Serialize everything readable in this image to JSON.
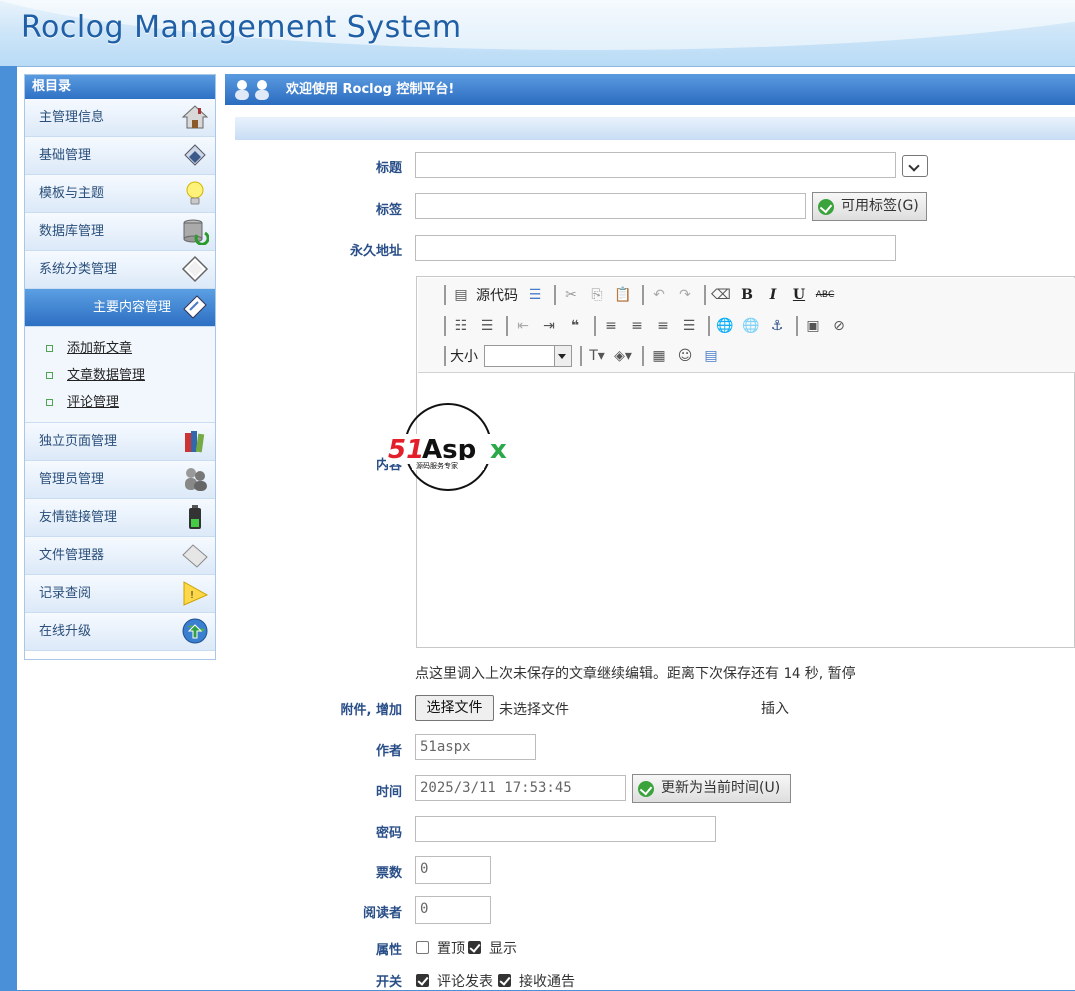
{
  "app": {
    "title": "Roclog Management System"
  },
  "sidebar": {
    "header": "根目录",
    "items": [
      {
        "label": "主管理信息",
        "icon": "house-icon"
      },
      {
        "label": "基础管理",
        "icon": "tools-icon"
      },
      {
        "label": "模板与主题",
        "icon": "lightbulb-icon"
      },
      {
        "label": "数据库管理",
        "icon": "database-icon"
      },
      {
        "label": "系统分类管理",
        "icon": "tag-icon"
      },
      {
        "label": "主要内容管理",
        "icon": "document-edit-icon"
      },
      {
        "label": "独立页面管理",
        "icon": "books-icon"
      },
      {
        "label": "管理员管理",
        "icon": "users-icon"
      },
      {
        "label": "友情链接管理",
        "icon": "battery-icon"
      },
      {
        "label": "文件管理器",
        "icon": "folder-icon"
      },
      {
        "label": "记录查阅",
        "icon": "warning-icon"
      },
      {
        "label": "在线升级",
        "icon": "globe-icon"
      }
    ],
    "subitems": [
      "添加新文章",
      "文章数据管理",
      "评论管理"
    ]
  },
  "main": {
    "header": "欢迎使用 Roclog 控制平台!",
    "form": {
      "title_label": "标题",
      "title_value": "",
      "tags_label": "标签",
      "tags_value": "",
      "tags_button": "可用标签(G)",
      "permalink_label": "永久地址",
      "permalink_value": "",
      "content_label": "内容",
      "toolbar": {
        "source_label": "源代码",
        "size_label": "大小",
        "size_value": ""
      },
      "autosave_prefix": "点这里调入上次未保存的文章继续编辑。距离下次保存还有 ",
      "autosave_seconds": "14",
      "autosave_suffix": " 秒, 暂停",
      "attach_label": "附件, 增加",
      "file_button": "选择文件",
      "file_status": "未选择文件",
      "insert_label": "插入",
      "author_label": "作者",
      "author_value": "51aspx",
      "time_label": "时间",
      "time_value": "2025/3/11 17:53:45",
      "time_button": "更新为当前时间(U)",
      "password_label": "密码",
      "password_value": "",
      "votes_label": "票数",
      "votes_value": "0",
      "readers_label": "阅读者",
      "readers_value": "0",
      "props_label": "属性",
      "prop_top": {
        "label": "置顶",
        "checked": false
      },
      "prop_show": {
        "label": "显示",
        "checked": true
      },
      "switch_label": "开关",
      "switch_comment": {
        "label": "评论发表",
        "checked": true
      },
      "switch_notify": {
        "label": "接收通告",
        "checked": true
      }
    }
  },
  "watermark": {
    "brand": "51Aspx",
    "tagline": "源码服务专家"
  },
  "colors": {
    "accent": "#2f71c4",
    "label": "#2a4f88",
    "banner_title": "#1f5fa6"
  }
}
